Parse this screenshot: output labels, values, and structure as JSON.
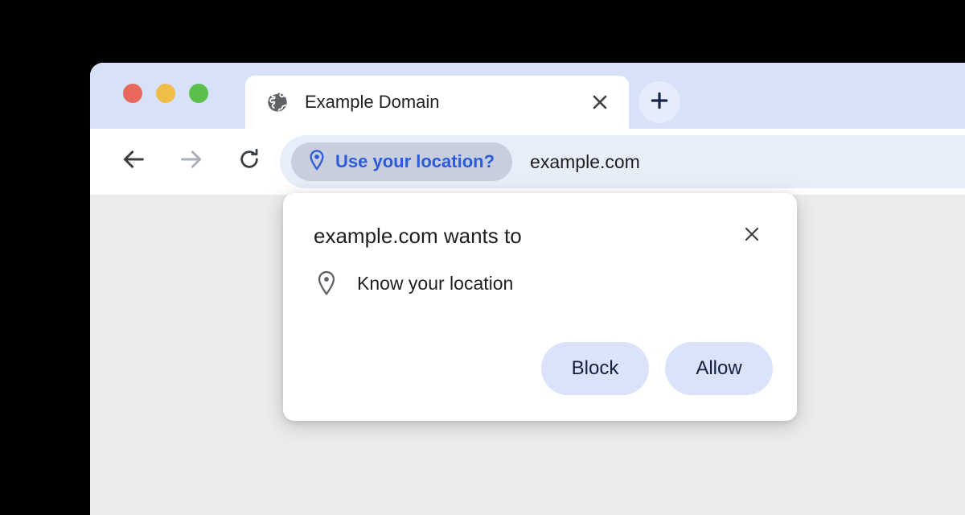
{
  "window": {
    "traffic_lights": [
      {
        "name": "close",
        "color": "#e8695b"
      },
      {
        "name": "minimize",
        "color": "#f0bd48"
      },
      {
        "name": "maximize",
        "color": "#5cbf4c"
      }
    ]
  },
  "tab_strip": {
    "active_tab": {
      "title": "Example Domain",
      "favicon": "globe-icon",
      "close_icon": "close-icon"
    },
    "new_tab": {
      "icon": "plus-icon",
      "label": "+"
    }
  },
  "toolbar": {
    "back": {
      "icon": "arrow-left-icon",
      "enabled": true
    },
    "forward": {
      "icon": "arrow-right-icon",
      "enabled": false
    },
    "reload": {
      "icon": "reload-icon",
      "enabled": true
    },
    "omnibox": {
      "chip": {
        "icon": "location-pin-icon",
        "label": "Use your location?",
        "text_color": "#2d5bd7",
        "background": "#c7cfde"
      },
      "url": "example.com",
      "background": "#e8edfa"
    }
  },
  "dialog": {
    "title": "example.com wants to",
    "close_icon": "close-icon",
    "permission": {
      "icon": "location-pin-icon",
      "label": "Know your location"
    },
    "buttons": [
      {
        "name": "block",
        "label": "Block"
      },
      {
        "name": "allow",
        "label": "Allow"
      }
    ],
    "button_background": "#dbe3fb",
    "button_text_color": "#13213f"
  },
  "page": {
    "background": "#ececec"
  }
}
